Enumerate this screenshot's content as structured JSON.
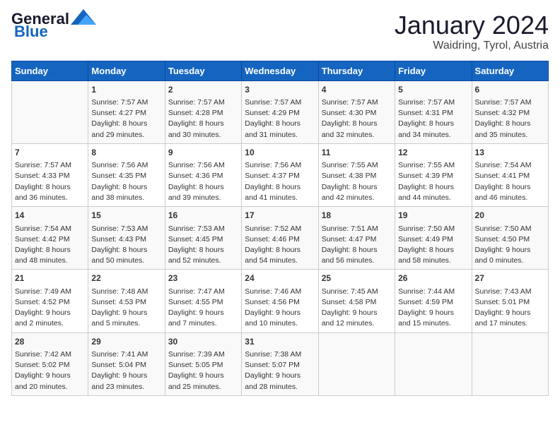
{
  "logo": {
    "line1": "General",
    "line2": "Blue"
  },
  "title": "January 2024",
  "subtitle": "Waidring, Tyrol, Austria",
  "headers": [
    "Sunday",
    "Monday",
    "Tuesday",
    "Wednesday",
    "Thursday",
    "Friday",
    "Saturday"
  ],
  "weeks": [
    [
      {
        "day": "",
        "content": ""
      },
      {
        "day": "1",
        "content": "Sunrise: 7:57 AM\nSunset: 4:27 PM\nDaylight: 8 hours\nand 29 minutes."
      },
      {
        "day": "2",
        "content": "Sunrise: 7:57 AM\nSunset: 4:28 PM\nDaylight: 8 hours\nand 30 minutes."
      },
      {
        "day": "3",
        "content": "Sunrise: 7:57 AM\nSunset: 4:29 PM\nDaylight: 8 hours\nand 31 minutes."
      },
      {
        "day": "4",
        "content": "Sunrise: 7:57 AM\nSunset: 4:30 PM\nDaylight: 8 hours\nand 32 minutes."
      },
      {
        "day": "5",
        "content": "Sunrise: 7:57 AM\nSunset: 4:31 PM\nDaylight: 8 hours\nand 34 minutes."
      },
      {
        "day": "6",
        "content": "Sunrise: 7:57 AM\nSunset: 4:32 PM\nDaylight: 8 hours\nand 35 minutes."
      }
    ],
    [
      {
        "day": "7",
        "content": "Sunrise: 7:57 AM\nSunset: 4:33 PM\nDaylight: 8 hours\nand 36 minutes."
      },
      {
        "day": "8",
        "content": "Sunrise: 7:56 AM\nSunset: 4:35 PM\nDaylight: 8 hours\nand 38 minutes."
      },
      {
        "day": "9",
        "content": "Sunrise: 7:56 AM\nSunset: 4:36 PM\nDaylight: 8 hours\nand 39 minutes."
      },
      {
        "day": "10",
        "content": "Sunrise: 7:56 AM\nSunset: 4:37 PM\nDaylight: 8 hours\nand 41 minutes."
      },
      {
        "day": "11",
        "content": "Sunrise: 7:55 AM\nSunset: 4:38 PM\nDaylight: 8 hours\nand 42 minutes."
      },
      {
        "day": "12",
        "content": "Sunrise: 7:55 AM\nSunset: 4:39 PM\nDaylight: 8 hours\nand 44 minutes."
      },
      {
        "day": "13",
        "content": "Sunrise: 7:54 AM\nSunset: 4:41 PM\nDaylight: 8 hours\nand 46 minutes."
      }
    ],
    [
      {
        "day": "14",
        "content": "Sunrise: 7:54 AM\nSunset: 4:42 PM\nDaylight: 8 hours\nand 48 minutes."
      },
      {
        "day": "15",
        "content": "Sunrise: 7:53 AM\nSunset: 4:43 PM\nDaylight: 8 hours\nand 50 minutes."
      },
      {
        "day": "16",
        "content": "Sunrise: 7:53 AM\nSunset: 4:45 PM\nDaylight: 8 hours\nand 52 minutes."
      },
      {
        "day": "17",
        "content": "Sunrise: 7:52 AM\nSunset: 4:46 PM\nDaylight: 8 hours\nand 54 minutes."
      },
      {
        "day": "18",
        "content": "Sunrise: 7:51 AM\nSunset: 4:47 PM\nDaylight: 8 hours\nand 56 minutes."
      },
      {
        "day": "19",
        "content": "Sunrise: 7:50 AM\nSunset: 4:49 PM\nDaylight: 8 hours\nand 58 minutes."
      },
      {
        "day": "20",
        "content": "Sunrise: 7:50 AM\nSunset: 4:50 PM\nDaylight: 9 hours\nand 0 minutes."
      }
    ],
    [
      {
        "day": "21",
        "content": "Sunrise: 7:49 AM\nSunset: 4:52 PM\nDaylight: 9 hours\nand 2 minutes."
      },
      {
        "day": "22",
        "content": "Sunrise: 7:48 AM\nSunset: 4:53 PM\nDaylight: 9 hours\nand 5 minutes."
      },
      {
        "day": "23",
        "content": "Sunrise: 7:47 AM\nSunset: 4:55 PM\nDaylight: 9 hours\nand 7 minutes."
      },
      {
        "day": "24",
        "content": "Sunrise: 7:46 AM\nSunset: 4:56 PM\nDaylight: 9 hours\nand 10 minutes."
      },
      {
        "day": "25",
        "content": "Sunrise: 7:45 AM\nSunset: 4:58 PM\nDaylight: 9 hours\nand 12 minutes."
      },
      {
        "day": "26",
        "content": "Sunrise: 7:44 AM\nSunset: 4:59 PM\nDaylight: 9 hours\nand 15 minutes."
      },
      {
        "day": "27",
        "content": "Sunrise: 7:43 AM\nSunset: 5:01 PM\nDaylight: 9 hours\nand 17 minutes."
      }
    ],
    [
      {
        "day": "28",
        "content": "Sunrise: 7:42 AM\nSunset: 5:02 PM\nDaylight: 9 hours\nand 20 minutes."
      },
      {
        "day": "29",
        "content": "Sunrise: 7:41 AM\nSunset: 5:04 PM\nDaylight: 9 hours\nand 23 minutes."
      },
      {
        "day": "30",
        "content": "Sunrise: 7:39 AM\nSunset: 5:05 PM\nDaylight: 9 hours\nand 25 minutes."
      },
      {
        "day": "31",
        "content": "Sunrise: 7:38 AM\nSunset: 5:07 PM\nDaylight: 9 hours\nand 28 minutes."
      },
      {
        "day": "",
        "content": ""
      },
      {
        "day": "",
        "content": ""
      },
      {
        "day": "",
        "content": ""
      }
    ]
  ]
}
